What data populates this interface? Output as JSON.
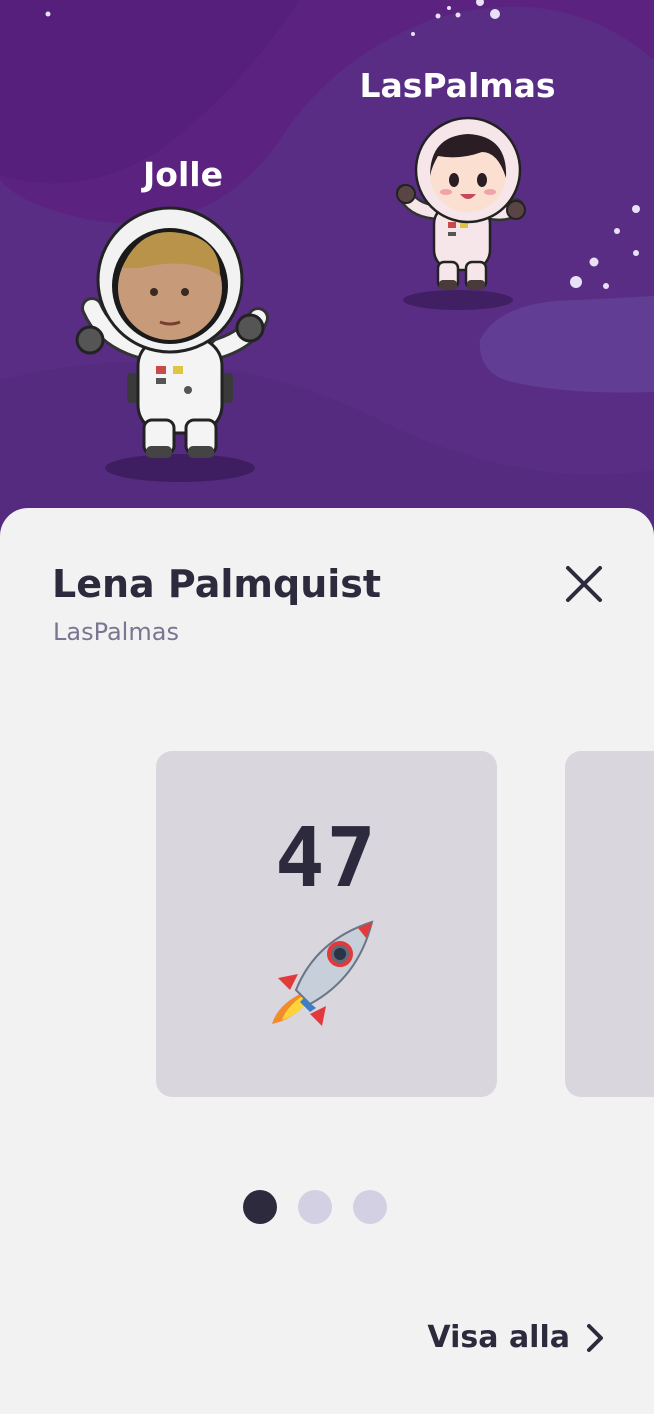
{
  "avatars": [
    {
      "name": "Jolle",
      "icon": "astronaut-photo-icon"
    },
    {
      "name": "LasPalmas",
      "icon": "astronaut-girl-icon"
    }
  ],
  "profile": {
    "name": "Lena Palmquist",
    "username": "LasPalmas"
  },
  "cards": [
    {
      "value": "47",
      "icon": "rocket-icon"
    }
  ],
  "pagination": {
    "total": 3,
    "active": 1
  },
  "footer": {
    "show_all_label": "Visa alla"
  },
  "colors": {
    "space_bg": "#5a2d85",
    "sheet_bg": "#f2f2f2",
    "card_bg": "#d9d6de",
    "text_dark": "#2e2a3d",
    "text_muted": "#7b7591",
    "dot_inactive": "#d3d0e3"
  }
}
